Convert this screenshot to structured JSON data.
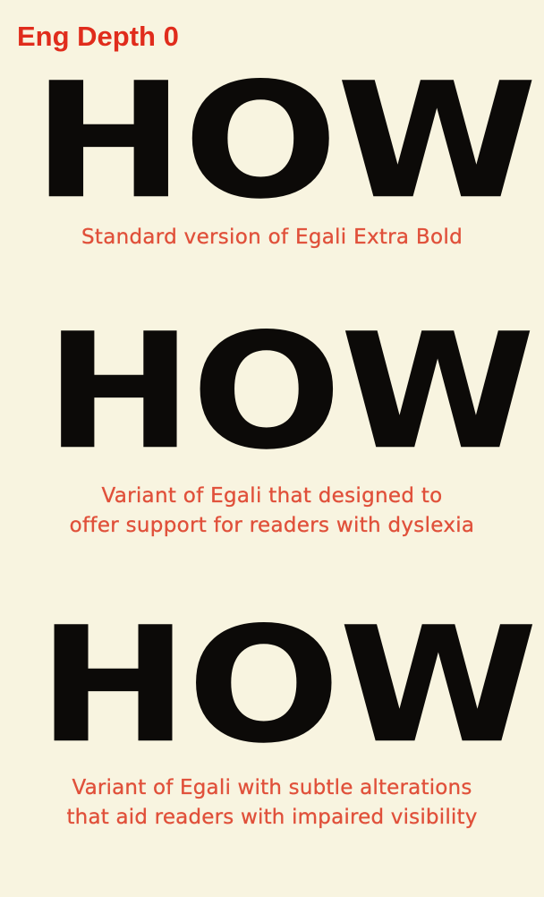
{
  "header": {
    "title": "Eng Depth 0"
  },
  "samples": [
    {
      "word": "HOW",
      "caption_lines": [
        "Standard version of Egali Extra Bold"
      ]
    },
    {
      "word": "HOW",
      "caption_lines": [
        "Variant of Egali that designed to",
        "offer support for readers with dyslexia"
      ]
    },
    {
      "word": "HOW",
      "caption_lines": [
        "Variant of Egali with subtle alterations",
        "that aid readers with impaired visibility"
      ]
    }
  ],
  "colors": {
    "background": "#f8f4e0",
    "title": "#e02c1c",
    "caption": "#e0503a",
    "glyph": "#0c0a08"
  }
}
